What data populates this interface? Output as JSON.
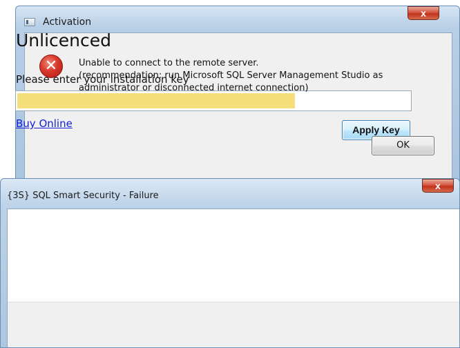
{
  "activation_window": {
    "title": "Activation",
    "close_label": "x",
    "heading": "Unlicenced",
    "key_label": "Please enter your installation key",
    "key_input_value": "",
    "buy_online_label": "Buy Online",
    "apply_key_label": "Apply Key",
    "highlight_color": "#f5df7a"
  },
  "failure_dialog": {
    "title": "{3S} SQL Smart Security - Failure",
    "close_label": "x",
    "message": "Unable to connect to the remote server.\n(recommendation: run Microsoft SQL Server Management Studio as administrator or disconnected internet connection)",
    "icon": "error-icon",
    "ok_label": "OK"
  }
}
